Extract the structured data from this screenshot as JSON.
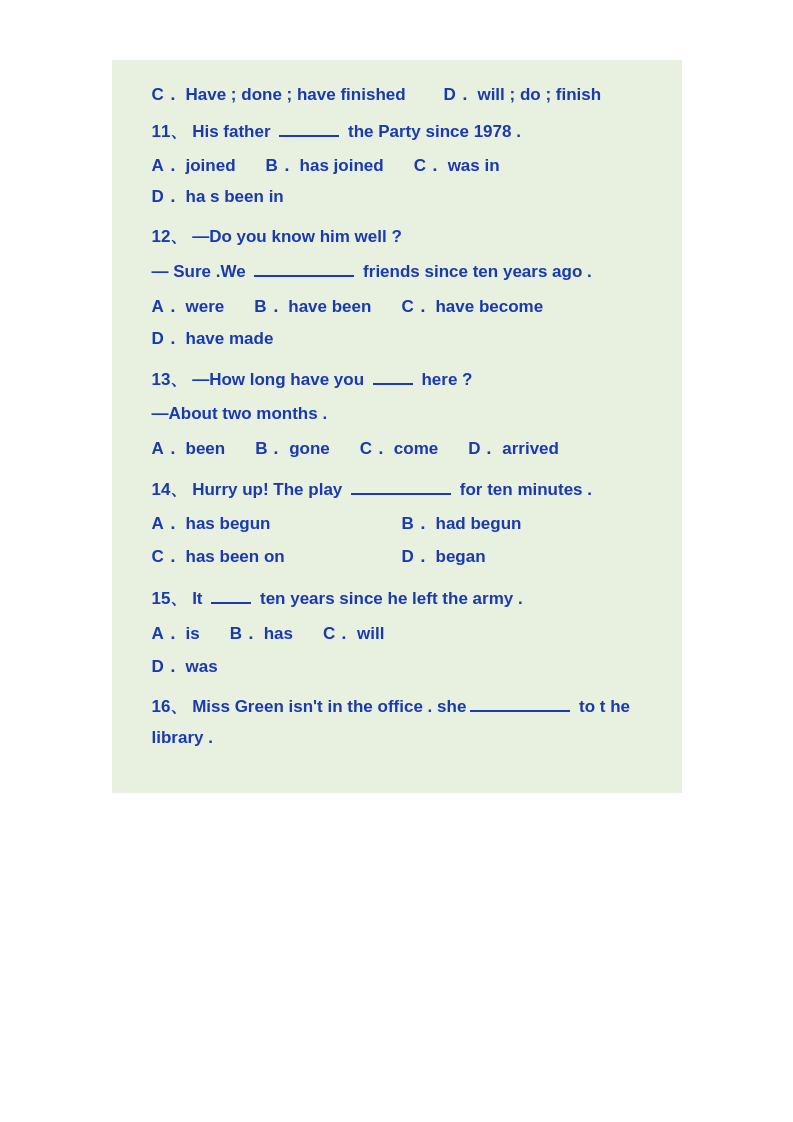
{
  "content": {
    "c_option": "C． Have ; done ; have  finished",
    "d_option": "D．  will ; do ; finish",
    "q11": {
      "num": "11",
      "text": "His  father  _____ the  Party  since  1978 .",
      "a": "A．  joined",
      "b": "B．  has joined",
      "c": "C．  was in",
      "d": "D．  ha s  been  in"
    },
    "q12": {
      "num": "12",
      "text1": "—Do  you  know  him  well  ?",
      "text2": "—  Sure .We  _________ friends  since  ten  years  ago  .",
      "a": "A．  were",
      "b": "B．  have been",
      "c": "C．  have become",
      "d": "D．  have made"
    },
    "q13": {
      "num": "13",
      "text1": "—How  long  have  you  ____  here  ?",
      "text2": "—About  two  months  .",
      "a": "A．  been",
      "b": "B．  gone",
      "c": "C．  come",
      "d": "D．  arrived"
    },
    "q14": {
      "num": "14",
      "text": "Hurry  up!  The  play  __________ for  ten  minutes  .",
      "a": "A．  has  begun",
      "b": "B．  had  begun",
      "c": "C．  has  been  on",
      "d": "D．  began"
    },
    "q15": {
      "num": "15",
      "text": "It  _____ ten  years  since  he  left  the  army  .",
      "a": "A．  is",
      "b": "B．  has",
      "c": "C．  will",
      "d": "D．  was"
    },
    "q16": {
      "num": "16",
      "text": "Miss  Green  isn't  in  the  office . she_______ to  t he  library  ."
    }
  }
}
